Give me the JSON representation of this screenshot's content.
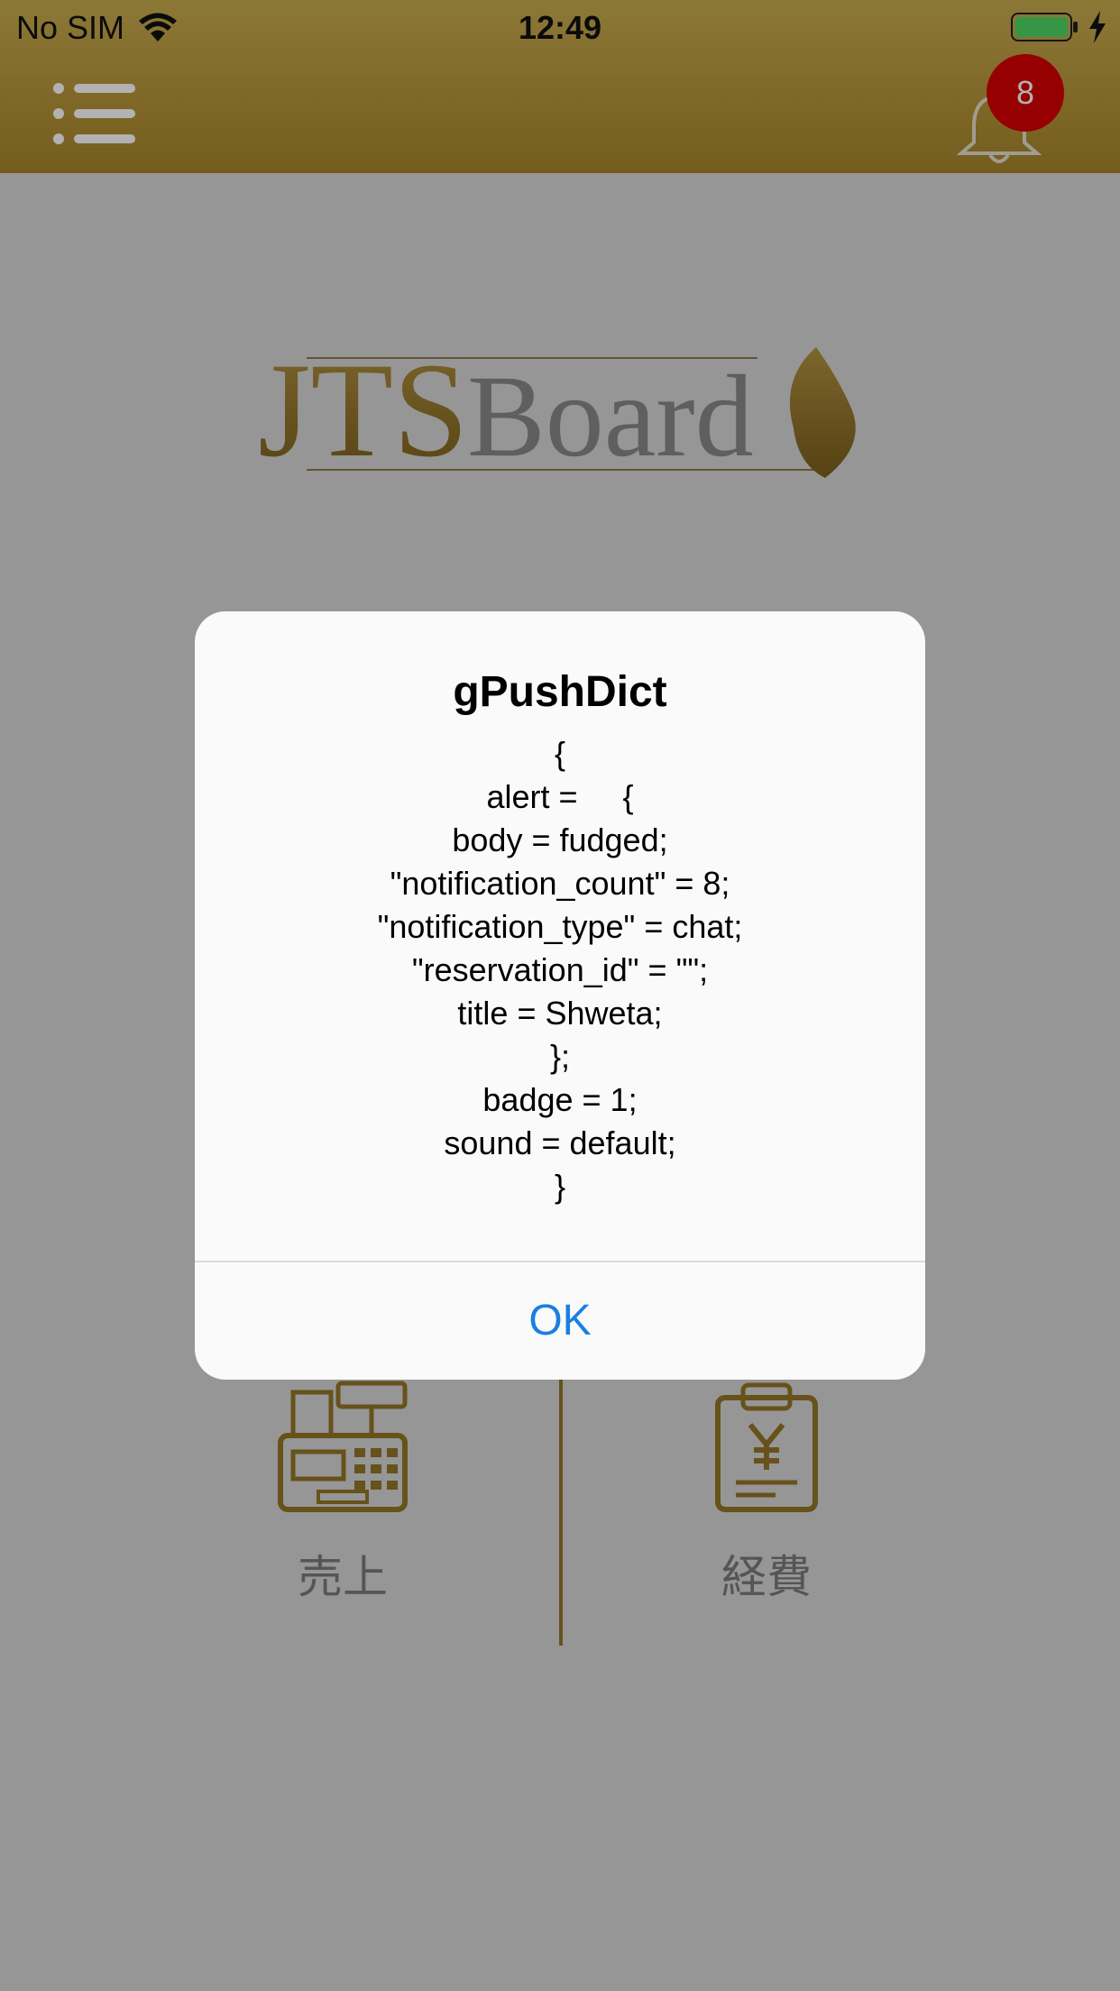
{
  "status_bar": {
    "carrier": "No SIM",
    "time": "12:49"
  },
  "nav_bar": {
    "notification_count": "8"
  },
  "logo": {
    "text_jts": "JTS",
    "text_board": "Board"
  },
  "menu": {
    "sales_label": "売上",
    "expenses_label": "経費"
  },
  "alert": {
    "title": "gPushDict",
    "message_lines": [
      "{",
      "alert =     {",
      "body = fudged;",
      "\"notification_count\" = 8;",
      "\"notification_type\" = chat;",
      "\"reservation_id\" = \"\";",
      "title = Shweta;",
      "};",
      "badge = 1;",
      "sound = default;",
      "}"
    ],
    "ok_label": "OK"
  },
  "colors": {
    "header_gold": "#b8963a",
    "accent_gold": "#a7852c",
    "badge_red": "#d90000",
    "link_blue": "#1a7fe0"
  }
}
